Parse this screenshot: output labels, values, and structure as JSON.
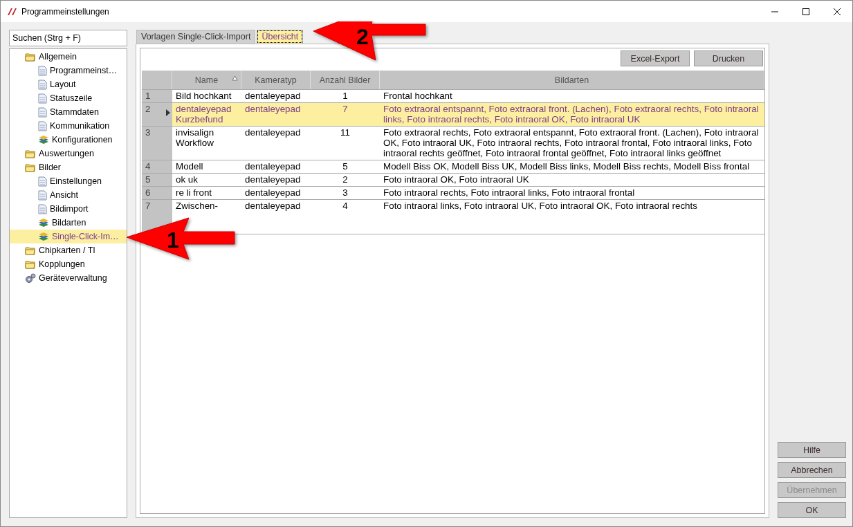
{
  "window": {
    "title": "Programmeinstellungen"
  },
  "search": {
    "placeholder": "Suchen (Strg + F)"
  },
  "tree": [
    {
      "label": "Allgemein",
      "kind": "folder",
      "selected": false,
      "children": [
        {
          "label": "Programmeinst…",
          "kind": "page",
          "selected": false
        },
        {
          "label": "Layout",
          "kind": "page",
          "selected": false
        },
        {
          "label": "Statuszeile",
          "kind": "page",
          "selected": false
        },
        {
          "label": "Stammdaten",
          "kind": "page",
          "selected": false
        },
        {
          "label": "Kommunikation",
          "kind": "page",
          "selected": false
        },
        {
          "label": "Konfigurationen",
          "kind": "books",
          "selected": false
        }
      ]
    },
    {
      "label": "Auswertungen",
      "kind": "folder",
      "selected": false
    },
    {
      "label": "Bilder",
      "kind": "folder",
      "selected": false,
      "children": [
        {
          "label": "Einstellungen",
          "kind": "page",
          "selected": false
        },
        {
          "label": "Ansicht",
          "kind": "page",
          "selected": false
        },
        {
          "label": "Bildimport",
          "kind": "page",
          "selected": false
        },
        {
          "label": "Bildarten",
          "kind": "books",
          "selected": false
        },
        {
          "label": "Single-Click-Im…",
          "kind": "books",
          "selected": true
        }
      ]
    },
    {
      "label": "Chipkarten / TI",
      "kind": "folder",
      "selected": false
    },
    {
      "label": "Kopplungen",
      "kind": "folder",
      "selected": false
    },
    {
      "label": "Geräteverwaltung",
      "kind": "gears",
      "selected": false
    }
  ],
  "tabs": [
    {
      "label": "Vorlagen Single-Click-Import",
      "selected": false
    },
    {
      "label": "Übersicht",
      "selected": true
    }
  ],
  "toolbar": [
    "Excel-Export",
    "Drucken"
  ],
  "table": {
    "columns": [
      "Name",
      "Kameratyp",
      "Anzahl Bilder",
      "Bildarten"
    ],
    "rows": [
      {
        "index": "1",
        "name": "Bild hochkant",
        "camera": "dentaleyepad",
        "count": "1",
        "types": "Frontal hochkant",
        "selected": false
      },
      {
        "index": "2",
        "name": "dentaleyepad Kurzbefund",
        "camera": "dentaleyepad",
        "count": "7",
        "types": "Foto extraoral entspannt, Foto extraoral front. (Lachen), Foto extraoral rechts, Foto intraoral links, Foto intraoral rechts, Foto intraoral OK, Foto intraoral UK",
        "selected": true
      },
      {
        "index": "3",
        "name": "invisalign Workflow",
        "camera": "dentaleyepad",
        "count": "11",
        "types": "Foto extraoral rechts, Foto extraoral entspannt, Foto extraoral front. (Lachen), Foto intraoral OK, Foto intraoral UK, Foto intraoral rechts, Foto intraoral frontal, Foto intraoral links, Foto intraoral rechts geöffnet, Foto intraoral frontal geöffnet, Foto intraoral links geöffnet",
        "selected": false
      },
      {
        "index": "4",
        "name": "Modell",
        "camera": "dentaleyepad",
        "count": "5",
        "types": "Modell Biss OK, Modell Biss UK, Modell Biss links, Modell Biss rechts, Modell Biss frontal",
        "selected": false
      },
      {
        "index": "5",
        "name": "ok uk",
        "camera": "dentaleyepad",
        "count": "2",
        "types": "Foto intraoral OK, Foto intraoral UK",
        "selected": false
      },
      {
        "index": "6",
        "name": "re li front",
        "camera": "dentaleyepad",
        "count": "3",
        "types": "Foto intraoral rechts, Foto intraoral links, Foto intraoral frontal",
        "selected": false
      },
      {
        "index": "7",
        "name": "Zwischen-",
        "camera": "dentaleyepad",
        "count": "4",
        "types": "Foto intraoral links, Foto intraoral UK, Foto intraoral OK, Foto intraoral rechts",
        "selected": false
      }
    ]
  },
  "buttons": [
    {
      "label": "Hilfe",
      "disabled": false
    },
    {
      "label": "Abbrechen",
      "disabled": false
    },
    {
      "label": "Übernehmen",
      "disabled": true
    },
    {
      "label": "OK",
      "disabled": false
    }
  ],
  "annotations": [
    {
      "label": "1"
    },
    {
      "label": "2"
    }
  ]
}
